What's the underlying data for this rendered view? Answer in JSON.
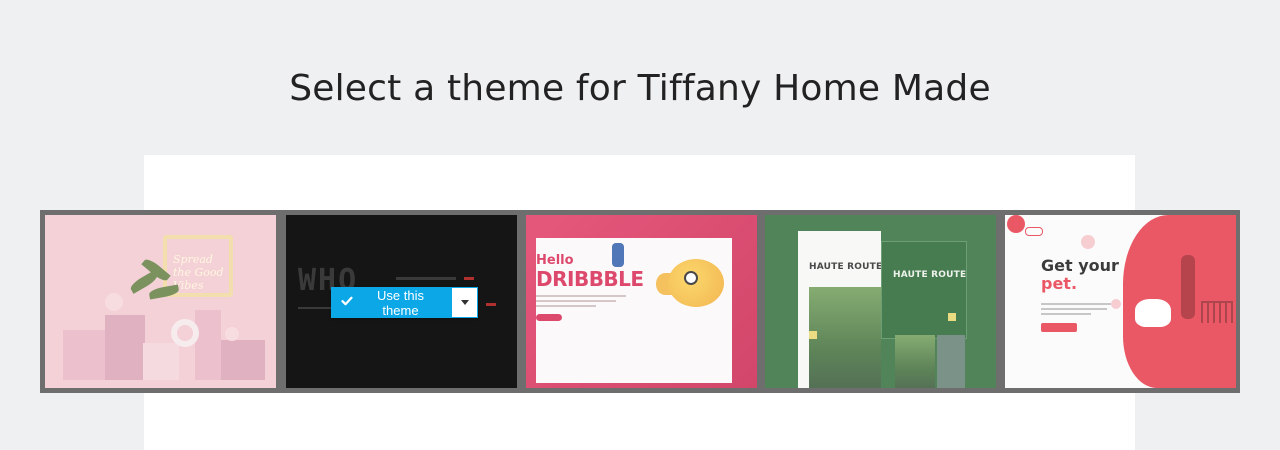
{
  "page": {
    "title": "Select a theme for Tiffany Home Made"
  },
  "theme_strip": {
    "themes": [
      {
        "id": "pink-3d",
        "preview_text": "Spread the Good Vibes"
      },
      {
        "id": "who",
        "preview_text": "WHO"
      },
      {
        "id": "hello-dribbble",
        "preview_text_1": "Hello",
        "preview_text_2": "DRIBBBLE"
      },
      {
        "id": "haute-route",
        "preview_text": "HAUTE ROUTE"
      },
      {
        "id": "get-your-pet",
        "preview_text_1": "Get your",
        "preview_text_2": "pet",
        "preview_punct": "."
      }
    ],
    "use_button": {
      "label": "Use this theme",
      "icon": "check-icon",
      "dropdown_icon": "caret-down-icon",
      "color": "#0ca7e6"
    }
  },
  "colors": {
    "background": "#eff0f2",
    "panel": "#ffffff",
    "strip_border": "#6e6e6e"
  }
}
